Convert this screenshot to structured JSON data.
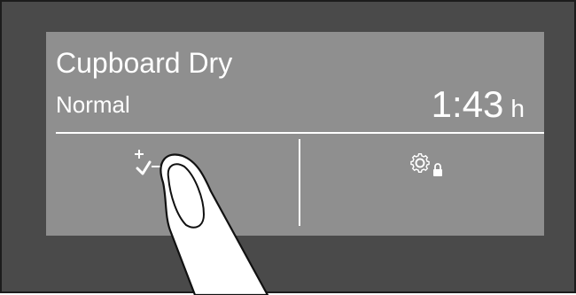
{
  "display": {
    "program_name": "Cupboard Dry",
    "program_option": "Normal",
    "remaining_time": "1:43",
    "time_unit": "h"
  },
  "buttons": {
    "options": {
      "icon": "checklist-plus-icon"
    },
    "settings": {
      "icon": "gear-lock-icon"
    }
  },
  "colors": {
    "frame": "#4a4a4a",
    "screen": "#8f8f8f",
    "text": "#ffffff"
  }
}
